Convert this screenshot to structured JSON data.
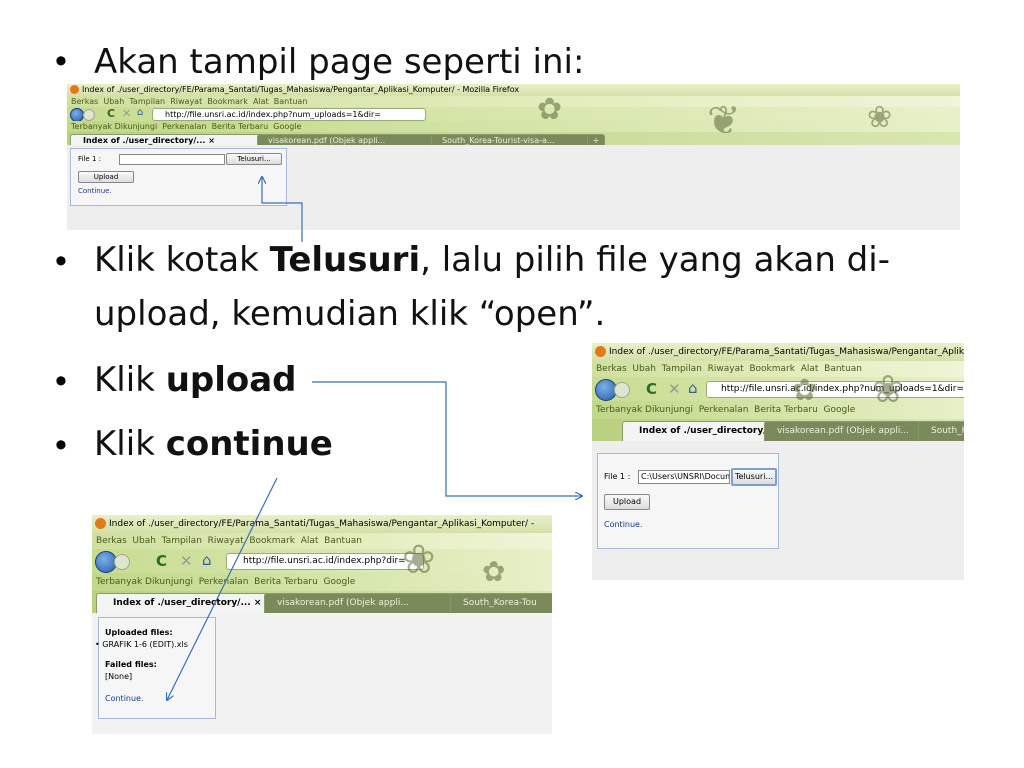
{
  "bullets": {
    "b1": "Akan tampil page seperti ini:",
    "b2_pre": "Klik kotak ",
    "b2_bold": "Telusuri",
    "b2_post1": ", lalu pilih file yang akan di-",
    "b2_post2": "upload, kemudian klik “open”.",
    "b3_pre": "Klik ",
    "b3_bold": "upload",
    "b4_pre": "Klik ",
    "b4_bold": "continue"
  },
  "browser": {
    "window_title": "Index of ./user_directory/FE/Parama_Santati/Tugas_Mahasiswa/Pengantar_Aplikasi_Komputer/ - Mozilla Firefox",
    "window_title_mid": "Index of ./user_directory/FE/Parama_Santati/Tugas_Mahasiswa/Pengantar_Aplikasi_Komputer/ -",
    "window_title_short": "Index of ./user_directory/FE/Parama_Santati/Tugas_Mahasiswa/Pengantar_Aplikasi_Kompu",
    "menu": [
      "Berkas",
      "Ubah",
      "Tampilan",
      "Riwayat",
      "Bookmark",
      "Alat",
      "Bantuan"
    ],
    "url_upload": "http://file.unsri.ac.id/index.php?num_uploads=1&dir=",
    "url_done": "http://file.unsri.ac.id/index.php?dir=",
    "bookmarks": [
      "Terbanyak Dikunjungi",
      "Perkenalan",
      "Berita Terbaru",
      "Google"
    ],
    "tab_active": "Index of ./user_directory/...",
    "tab_close": "×",
    "tab_pdf": "visakorean.pdf (Objek appli...",
    "tab_korea": "South_Korea-Tourist-visa-a...",
    "tab_korea_short": "South_Korea-Tou",
    "tab_korea_short2": "South_Korea",
    "new_tab": "+"
  },
  "upload_form": {
    "file_label": "File 1 :",
    "file_value": "C:\\Users\\UNSRI\\Docum",
    "browse_button": "Telusuri...",
    "upload_button": "Upload",
    "continue_link": "Continue."
  },
  "result": {
    "uploaded_heading": "Uploaded files:",
    "uploaded_item": "GRAFIK 1-6 (EDIT).xls",
    "failed_heading": "Failed files:",
    "failed_value": "[None]",
    "continue_link": "Continue."
  },
  "colors": {
    "arrow": "#3a6fb8",
    "theme_green": "#cfe0a0"
  }
}
